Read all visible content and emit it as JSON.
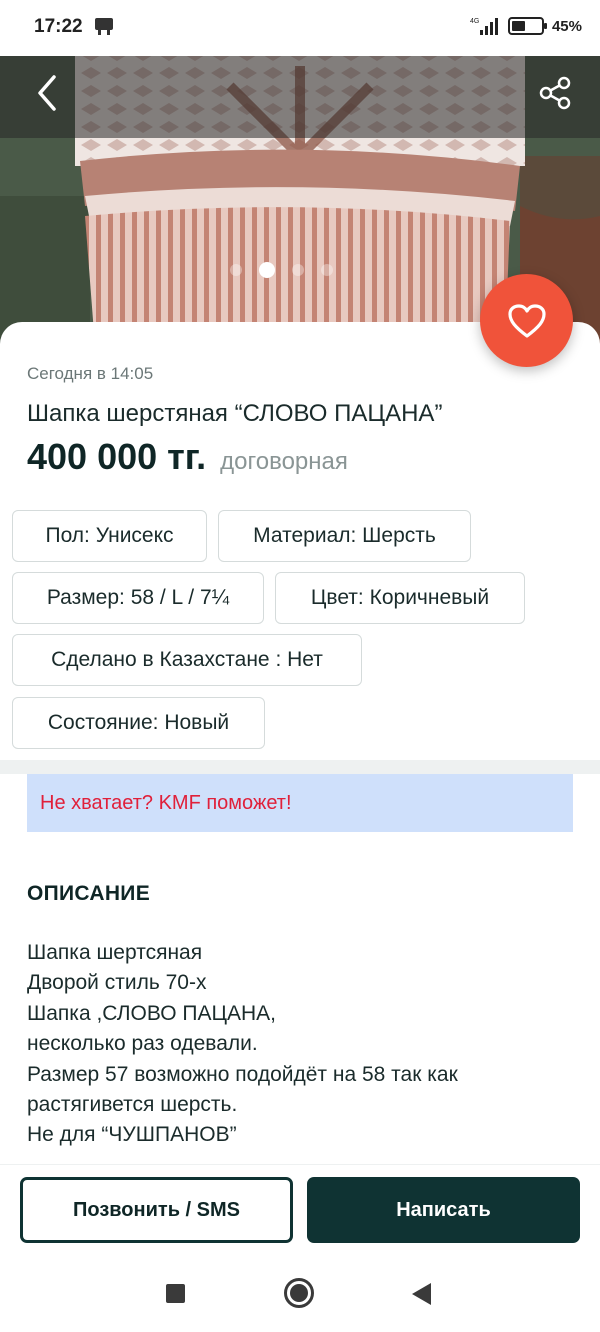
{
  "status_bar": {
    "time": "17:22",
    "network": "4G",
    "battery_percent": "45%",
    "battery_level": 0.45
  },
  "gallery": {
    "photo_count": 4,
    "active_index": 1
  },
  "listing": {
    "date": "Сегодня в 14:05",
    "title": "Шапка шерстяная “СЛОВО ПАЦАНА”",
    "price": "400 000 тг.",
    "price_note": "договорная",
    "attributes": [
      "Пол: Унисекс",
      "Материал: Шерсть",
      "Размер: 58 / L / 7¼",
      "Цвет: Коричневый",
      "Сделано в Казахстане : Нет",
      "Состояние: Новый"
    ]
  },
  "promo": {
    "text": "Не хватает? KMF поможет!"
  },
  "description": {
    "heading": "ОПИСАНИЕ",
    "lines": [
      "Шапка шертсяная",
      "Дворой стиль 70-х",
      "Шапка ,СЛОВО ПАЦАНА,",
      "несколько раз одевали.",
      "Размер 57 возможно подойдёт на 58 так как",
      "растягивется шерсть.",
      "Не для “ЧУШПАНОВ”"
    ]
  },
  "actions": {
    "call_label": "Позвонить / SMS",
    "write_label": "Написать"
  },
  "colors": {
    "accent": "#f0533a",
    "primary_dark": "#0f3333",
    "promo_bg": "#cfe0fb",
    "promo_text": "#e0203a"
  },
  "icons": {
    "back": "chevron-left-icon",
    "share": "share-icon",
    "favorite": "heart-icon"
  }
}
